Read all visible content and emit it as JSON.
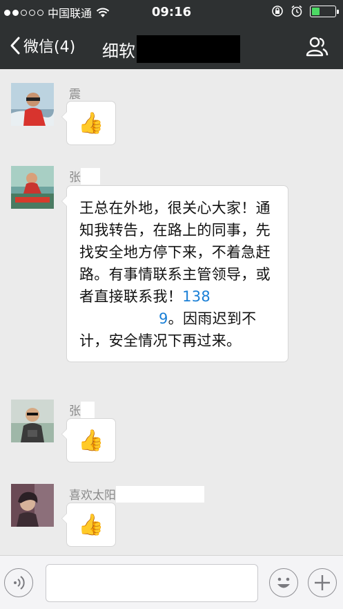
{
  "status_bar": {
    "carrier": "中国联通",
    "time": "09:16",
    "battery_level": 0.35,
    "colors": {
      "battery_fill": "#4cd964"
    }
  },
  "nav": {
    "back_label": "微信(4)",
    "title": "细软",
    "icons": {
      "back": "chevron-left-icon",
      "contacts": "chat-members-icon"
    }
  },
  "messages": [
    {
      "sender": "震",
      "type": "emoji",
      "emoji": "👍"
    },
    {
      "sender": "张",
      "type": "text",
      "text_before_phone": "王总在外地，很关心大家！通知我转告，在路上的同事，先找安全地方停下来，不着急赶路。有事情联系主管领导，或者直接联系我！",
      "phone_start": "138",
      "phone_end": "9",
      "text_after_phone": "。因雨迟到不计，安全情况下再过来。"
    },
    {
      "sender": "张",
      "type": "emoji",
      "emoji": "👍"
    },
    {
      "sender": "喜欢太阳",
      "type": "emoji",
      "emoji": "👍"
    }
  ],
  "input_bar": {
    "icons": {
      "voice": "voice-icon",
      "emoji": "emoji-icon",
      "more": "plus-icon"
    }
  }
}
